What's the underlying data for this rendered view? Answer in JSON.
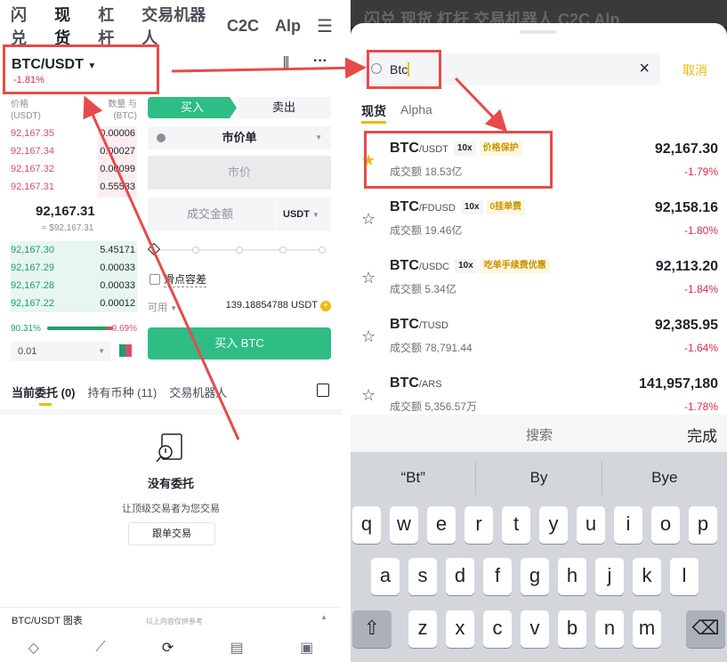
{
  "left": {
    "topnav": {
      "items": [
        "闪兑",
        "现货",
        "杠杆",
        "交易机器人",
        "C2C",
        "Alp"
      ],
      "active": 1,
      "menu_icon": "hamburger-icon"
    },
    "pair": "BTC/USDT",
    "pair_change": "-1.81%",
    "orderbook": {
      "price_header": "价格",
      "price_unit": "(USDT)",
      "qty_header": "数量 与",
      "qty_unit": "(BTC)",
      "asks": [
        {
          "price": "92,167.35",
          "qty": "0.00006"
        },
        {
          "price": "92,167.34",
          "qty": "0.00027"
        },
        {
          "price": "92,167.32",
          "qty": "0.00099"
        },
        {
          "price": "92,167.31",
          "qty": "0.55533"
        }
      ],
      "mid_price": "92,167.31",
      "mid_sub": "≈ $92,167.31",
      "bids": [
        {
          "price": "92,167.30",
          "qty": "5.45171"
        },
        {
          "price": "92,167.29",
          "qty": "0.00033"
        },
        {
          "price": "92,167.28",
          "qty": "0.00033"
        },
        {
          "price": "92,167.22",
          "qty": "0.00012"
        }
      ],
      "buy_ratio": "90.31%",
      "sell_ratio": "9.69%",
      "buy_ratio_value": 0.9031,
      "step": "0.01"
    },
    "form": {
      "buy_tab": "买入",
      "sell_tab": "卖出",
      "order_type": "市价单",
      "price_placeholder": "市价",
      "amount_label": "成交金额",
      "amount_unit": "USDT",
      "slippage": "滑点容差",
      "avail_label": "可用",
      "avail_value": "139.18854788 USDT",
      "buy_button": "买入 BTC"
    },
    "subtabs": [
      "当前委托 (0)",
      "持有币种 (11)",
      "交易机器人"
    ],
    "empty": {
      "title": "没有委托",
      "subtitle": "让顶级交易者为您交易",
      "button": "跟单交易"
    },
    "chart_bar": {
      "label": "BTC/USDT 图表",
      "hint": "以上内容仅供参考"
    }
  },
  "right": {
    "dim_nav": "闪兑  现货  杠杆  交易机器人  C2C  Alp",
    "search_value": "Btc",
    "cancel": "取消",
    "tabs": [
      "现货",
      "Alpha"
    ],
    "results": [
      {
        "base": "BTC",
        "quote": "/USDT",
        "lev": "10x",
        "tag": "价格保护",
        "vol": "成交额 18.53亿",
        "price": "92,167.30",
        "change": "-1.79%",
        "fav": true
      },
      {
        "base": "BTC",
        "quote": "/FDUSD",
        "lev": "10x",
        "tag": "0挂单费",
        "vol": "成交额 19.46亿",
        "price": "92,158.16",
        "change": "-1.80%",
        "fav": false
      },
      {
        "base": "BTC",
        "quote": "/USDC",
        "lev": "10x",
        "tag": "吃单手续费优惠",
        "vol": "成交额 5.34亿",
        "price": "92,113.20",
        "change": "-1.84%",
        "fav": false
      },
      {
        "base": "BTC",
        "quote": "/TUSD",
        "lev": "",
        "tag": "",
        "vol": "成交额 78,791.44",
        "price": "92,385.95",
        "change": "-1.64%",
        "fav": false
      },
      {
        "base": "BTC",
        "quote": "/ARS",
        "lev": "",
        "tag": "",
        "vol": "成交额 5,356.57万",
        "price": "141,957,180",
        "change": "-1.78%",
        "fav": false
      }
    ],
    "keyboard": {
      "search_label": "搜索",
      "done_label": "完成",
      "suggestions": [
        "“Bt”",
        "By",
        "Bye"
      ],
      "row1": [
        "q",
        "w",
        "e",
        "r",
        "t",
        "y",
        "u",
        "i",
        "o",
        "p"
      ],
      "row2": [
        "a",
        "s",
        "d",
        "f",
        "g",
        "h",
        "j",
        "k",
        "l"
      ],
      "row3": [
        "z",
        "x",
        "c",
        "v",
        "b",
        "n",
        "m"
      ]
    }
  },
  "colors": {
    "green": "#2ebd85",
    "red": "#e0294a",
    "yellow": "#f0b90b",
    "annotation": "#e84a4a"
  }
}
